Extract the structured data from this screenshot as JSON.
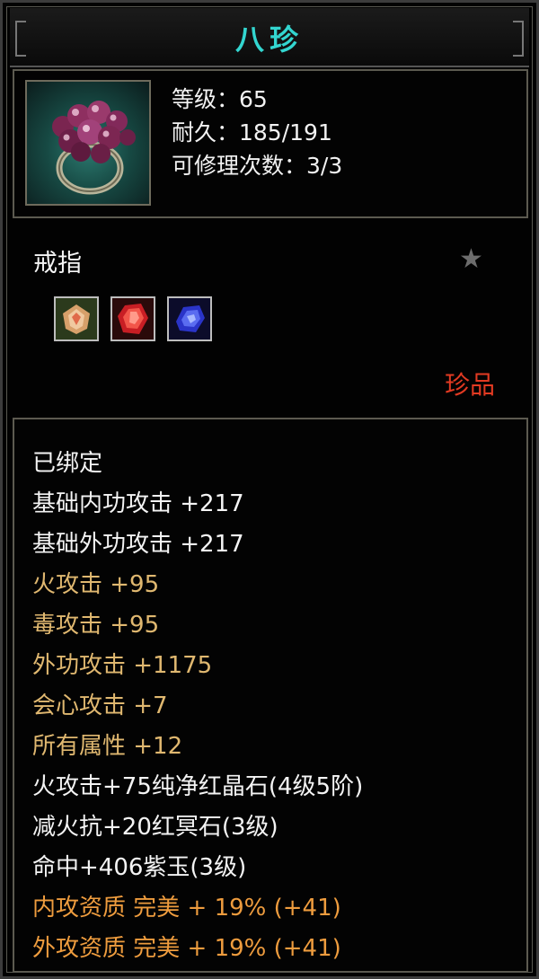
{
  "item": {
    "name": "八珍",
    "stats": {
      "level": "等级：65",
      "durability": "耐久：185/191",
      "repairs": "可修理次数：3/3"
    },
    "type": "戒指",
    "rarity": "珍品",
    "sockets": [
      {
        "icon": "topaz-gem-icon",
        "color": "#d9a060"
      },
      {
        "icon": "ruby-gem-icon",
        "color": "#d8262a"
      },
      {
        "icon": "sapphire-gem-icon",
        "color": "#3440d8"
      }
    ]
  },
  "attributes": [
    {
      "text": "已绑定",
      "style": "white"
    },
    {
      "text": "基础内功攻击  +217",
      "style": "white"
    },
    {
      "text": "基础外功攻击  +217",
      "style": "white"
    },
    {
      "text": "火攻击  +95",
      "style": "gold"
    },
    {
      "text": "毒攻击  +95",
      "style": "gold"
    },
    {
      "text": "外功攻击  +1175",
      "style": "gold"
    },
    {
      "text": "会心攻击  +7",
      "style": "gold"
    },
    {
      "text": "所有属性  +12",
      "style": "gold"
    },
    {
      "text": "火攻击+75纯净红晶石(4级5阶)",
      "style": "white"
    },
    {
      "text": "减火抗+20红冥石(3级)",
      "style": "white"
    },
    {
      "text": "命中+406紫玉(3级)",
      "style": "white"
    },
    {
      "text": "内攻资质  完美  + 19% (+41)",
      "style": "orange"
    },
    {
      "text": "外攻资质  完美  + 19% (+41)",
      "style": "orange"
    }
  ],
  "colors": {
    "title": "#33d6d0",
    "rarity": "#e23a22",
    "bonus": "#e0b870",
    "aptitude": "#ee9c3e"
  }
}
